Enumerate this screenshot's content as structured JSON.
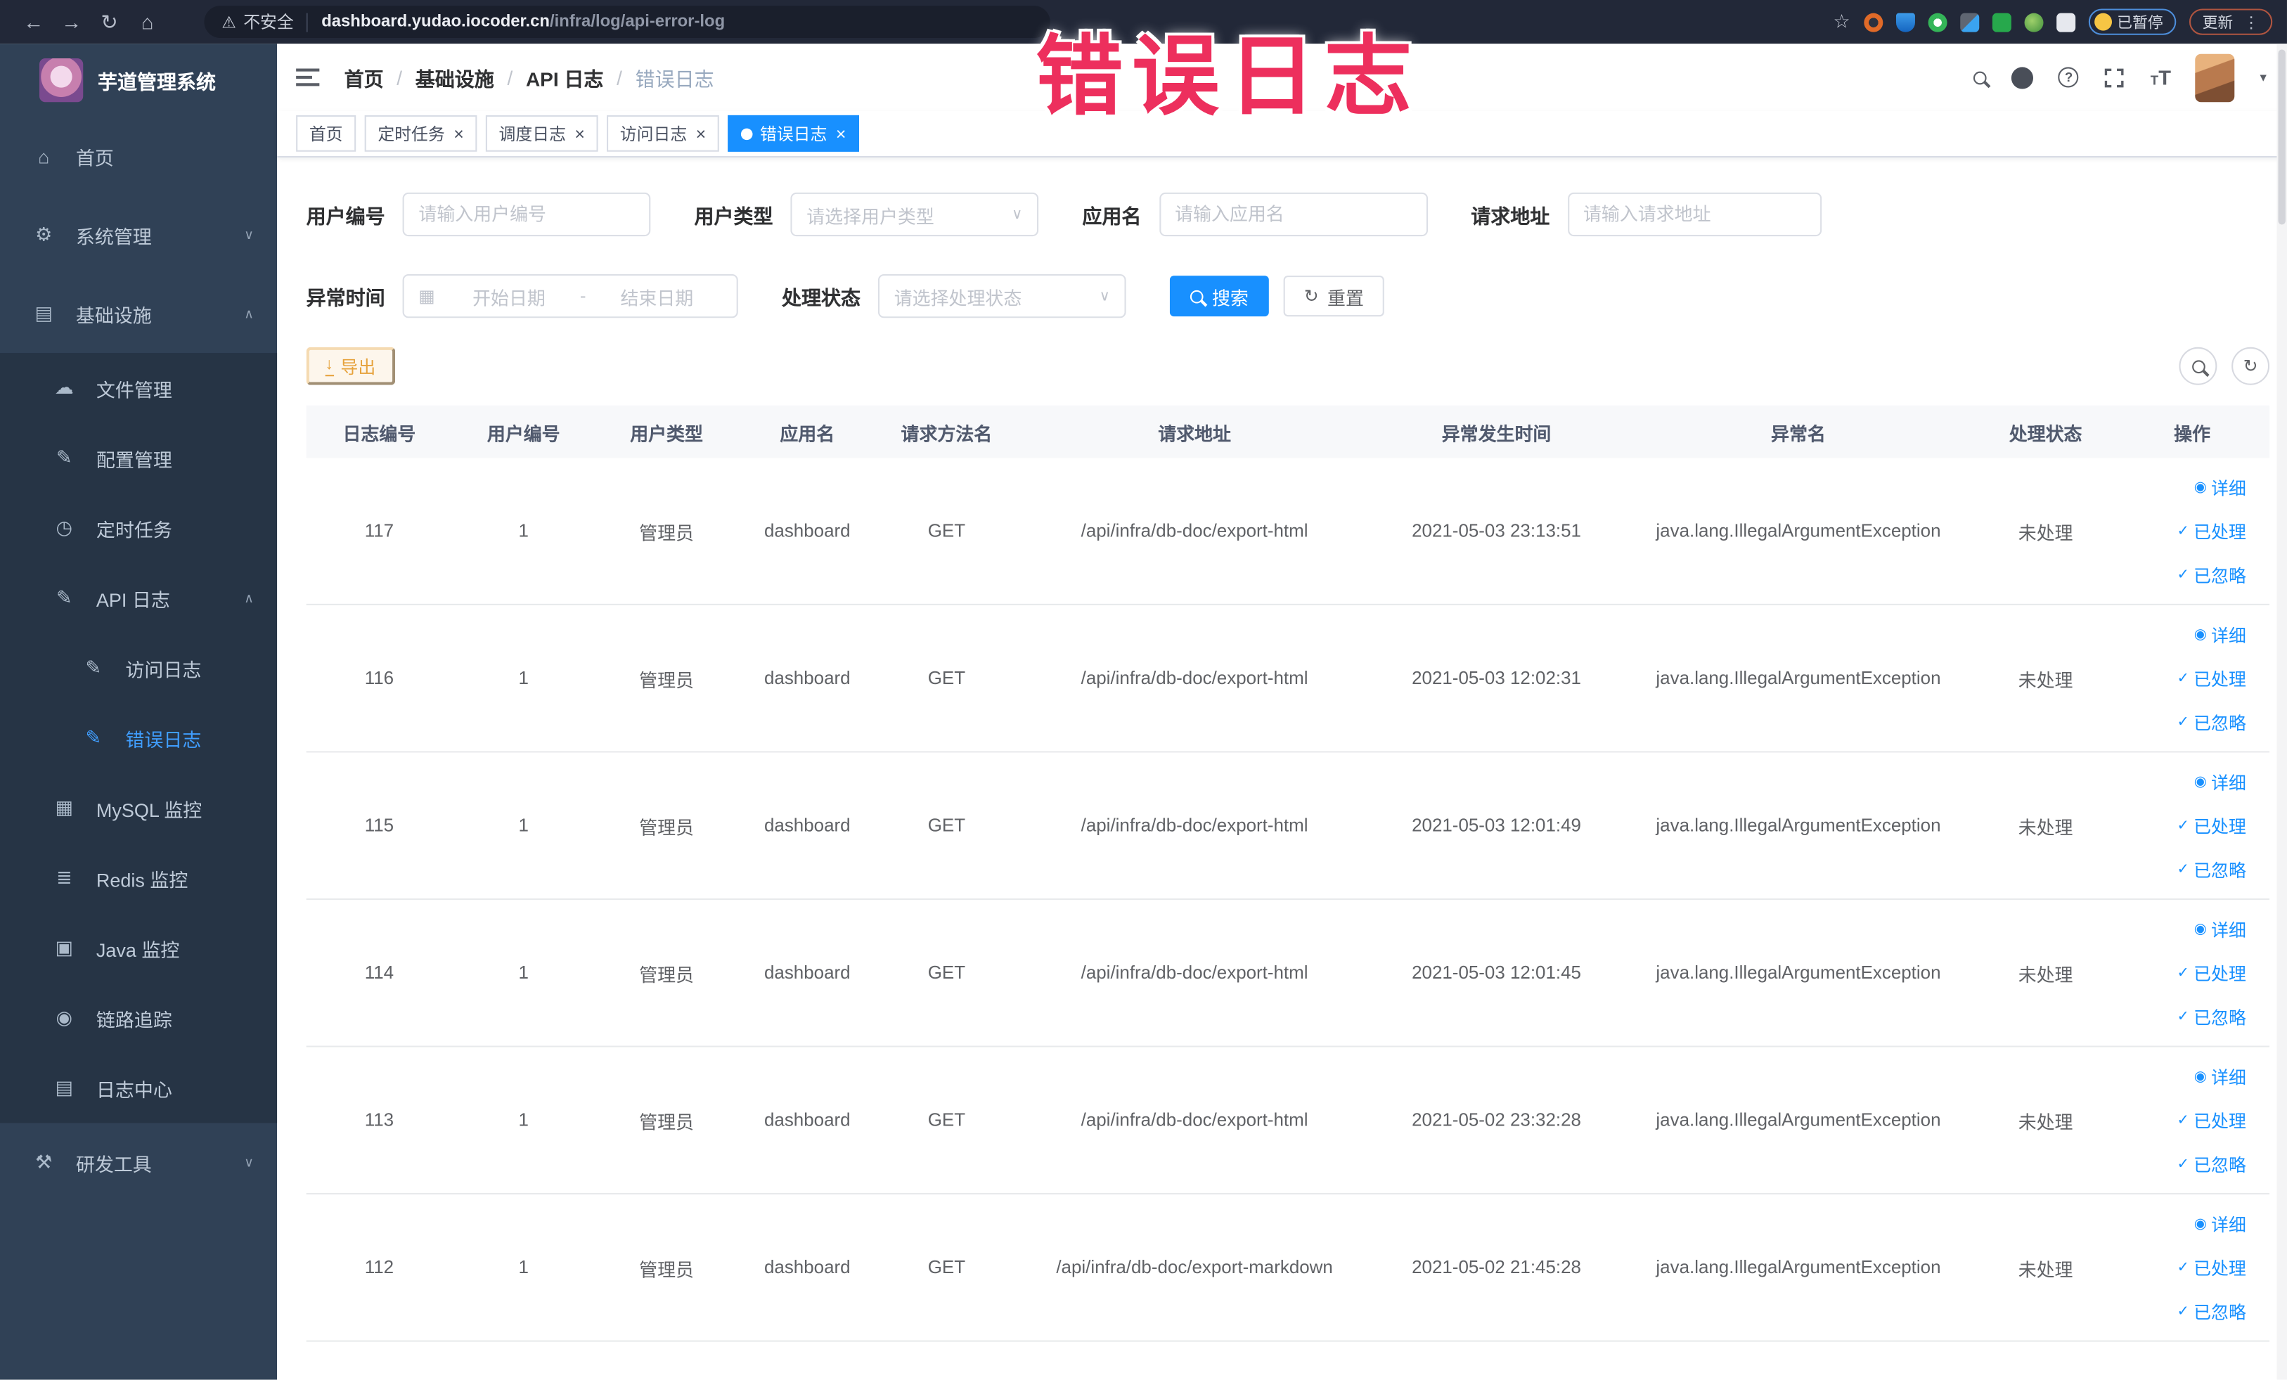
{
  "browser": {
    "security_label": "不安全",
    "url_domain": "dashboard.yudao.iocoder.cn",
    "url_path": "/infra/log/api-error-log",
    "paused_label": "已暂停",
    "update_label": "更新"
  },
  "annotation": "错误日志",
  "sidebar": {
    "title": "芋道管理系统",
    "items": [
      {
        "label": "首页"
      },
      {
        "label": "系统管理"
      },
      {
        "label": "基础设施"
      },
      {
        "label": "文件管理"
      },
      {
        "label": "配置管理"
      },
      {
        "label": "定时任务"
      },
      {
        "label": "API 日志"
      },
      {
        "label": "访问日志"
      },
      {
        "label": "错误日志"
      },
      {
        "label": "MySQL 监控"
      },
      {
        "label": "Redis 监控"
      },
      {
        "label": "Java 监控"
      },
      {
        "label": "链路追踪"
      },
      {
        "label": "日志中心"
      },
      {
        "label": "研发工具"
      }
    ]
  },
  "breadcrumb": {
    "items": [
      "首页",
      "基础设施",
      "API 日志",
      "错误日志"
    ]
  },
  "tabs": [
    {
      "label": "首页"
    },
    {
      "label": "定时任务"
    },
    {
      "label": "调度日志"
    },
    {
      "label": "访问日志"
    },
    {
      "label": "错误日志"
    }
  ],
  "filters": {
    "user_id_label": "用户编号",
    "user_id_placeholder": "请输入用户编号",
    "user_type_label": "用户类型",
    "user_type_placeholder": "请选择用户类型",
    "app_name_label": "应用名",
    "app_name_placeholder": "请输入应用名",
    "request_url_label": "请求地址",
    "request_url_placeholder": "请输入请求地址",
    "time_label": "异常时间",
    "time_start_placeholder": "开始日期",
    "time_separator": "-",
    "time_end_placeholder": "结束日期",
    "status_label": "处理状态",
    "status_placeholder": "请选择处理状态",
    "search_label": "搜索",
    "reset_label": "重置"
  },
  "toolbar": {
    "export_label": "导出"
  },
  "table": {
    "columns": [
      "日志编号",
      "用户编号",
      "用户类型",
      "应用名",
      "请求方法名",
      "请求地址",
      "异常发生时间",
      "异常名",
      "处理状态",
      "操作"
    ],
    "actions": {
      "detail": "详细",
      "processed": "已处理",
      "ignored": "已忽略"
    },
    "rows": [
      {
        "id": "117",
        "user_id": "1",
        "user_type": "管理员",
        "app": "dashboard",
        "method": "GET",
        "url": "/api/infra/db-doc/export-html",
        "time": "2021-05-03 23:13:51",
        "exception": "java.lang.IllegalArgumentException",
        "status": "未处理"
      },
      {
        "id": "116",
        "user_id": "1",
        "user_type": "管理员",
        "app": "dashboard",
        "method": "GET",
        "url": "/api/infra/db-doc/export-html",
        "time": "2021-05-03 12:02:31",
        "exception": "java.lang.IllegalArgumentException",
        "status": "未处理"
      },
      {
        "id": "115",
        "user_id": "1",
        "user_type": "管理员",
        "app": "dashboard",
        "method": "GET",
        "url": "/api/infra/db-doc/export-html",
        "time": "2021-05-03 12:01:49",
        "exception": "java.lang.IllegalArgumentException",
        "status": "未处理"
      },
      {
        "id": "114",
        "user_id": "1",
        "user_type": "管理员",
        "app": "dashboard",
        "method": "GET",
        "url": "/api/infra/db-doc/export-html",
        "time": "2021-05-03 12:01:45",
        "exception": "java.lang.IllegalArgumentException",
        "status": "未处理"
      },
      {
        "id": "113",
        "user_id": "1",
        "user_type": "管理员",
        "app": "dashboard",
        "method": "GET",
        "url": "/api/infra/db-doc/export-html",
        "time": "2021-05-02 23:32:28",
        "exception": "java.lang.IllegalArgumentException",
        "status": "未处理"
      },
      {
        "id": "112",
        "user_id": "1",
        "user_type": "管理员",
        "app": "dashboard",
        "method": "GET",
        "url": "/api/infra/db-doc/export-markdown",
        "time": "2021-05-02 21:45:28",
        "exception": "java.lang.IllegalArgumentException",
        "status": "未处理"
      }
    ]
  },
  "colors": {
    "accent": "#1890ff",
    "menu_active": "#409eff",
    "warning": "#e6a23c",
    "annotation": "#ed2f5d",
    "sidebar_bg": "#304156",
    "submenu_bg": "#263445",
    "chrome_bg": "#222838"
  }
}
